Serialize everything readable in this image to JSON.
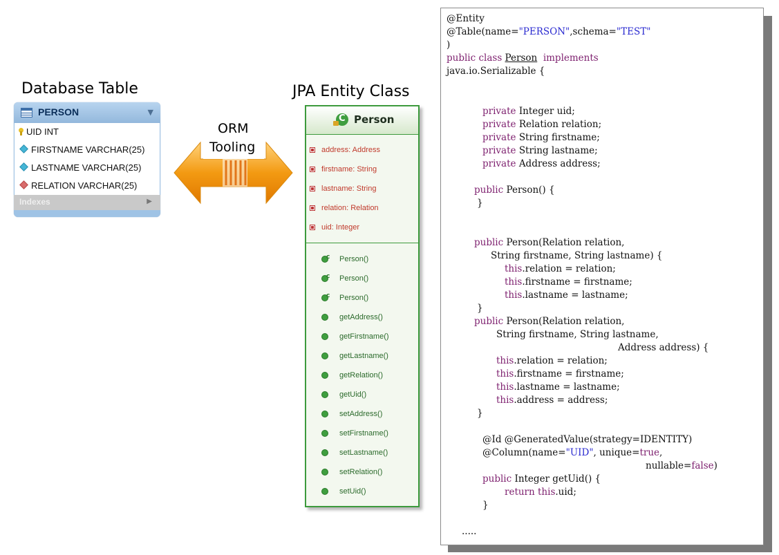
{
  "headings": {
    "db": "Database Table",
    "jpa": "JPA Entity Class",
    "orm_line1": "ORM",
    "orm_line2": "Tooling"
  },
  "db_table": {
    "name": "PERSON",
    "columns": [
      "UID INT",
      "FIRSTNAME VARCHAR(25)",
      "LASTNAME VARCHAR(25)",
      "RELATION VARCHAR(25)"
    ],
    "footer": "Indexes"
  },
  "uml": {
    "class_name": "Person",
    "attributes": [
      "address: Address",
      "firstname: String",
      "lastname: String",
      "relation: Relation",
      "uid: Integer"
    ],
    "constructors": [
      "Person()",
      "Person()",
      "Person()"
    ],
    "methods": [
      "getAddress()",
      "getFirstname()",
      "getLastname()",
      "getRelation()",
      "getUid()",
      "setAddress()",
      "setFirstname()",
      "setLastname()",
      "setRelation()",
      "setUid()"
    ]
  },
  "code": {
    "l1": "@Entity",
    "l2a": "@Table(name=",
    "l2b": "\"PERSON\"",
    "l2c": ",schema=",
    "l2d": "\"TEST\"",
    "l3": ")",
    "l4a": "public class",
    "l4b": "Person",
    "l4c": "implements",
    "l5": "java.io.Serializable {",
    "f1a": "private",
    "f1b": "Integer uid;",
    "f2a": "private",
    "f2b": "Relation relation;",
    "f3a": "private",
    "f3b": "String firstname;",
    "f4a": "private",
    "f4b": "String lastname;",
    "f5a": "private",
    "f5b": "Address address;",
    "c1a": "public",
    "c1b": "Person() {",
    "c1c": "}",
    "c2a": "public",
    "c2b": "Person(Relation relation,",
    "c2c": "String firstname, String lastname) {",
    "c2d": "this",
    "c2e": ".relation = relation;",
    "c2f": "this",
    "c2g": ".firstname = firstname;",
    "c2h": "this",
    "c2i": ".lastname = lastname;",
    "c2j": "}",
    "c3a": "public",
    "c3b": "Person(Relation relation,",
    "c3c": "String firstname, String lastname,",
    "c3d": "Address address) {",
    "c3e": "this",
    "c3f": ".relation = relation;",
    "c3g": "this",
    "c3h": ".firstname = firstname;",
    "c3i": "this",
    "c3j": ".lastname = lastname;",
    "c3k": "this",
    "c3l": ".address = address;",
    "c3m": "}",
    "a1": "@Id @GeneratedValue(strategy=IDENTITY)",
    "a2a": "@Column(name=",
    "a2b": "\"UID\"",
    "a2c": ", unique=",
    "a2d": "true",
    "a2e": ",",
    "a3a": "nullable=",
    "a3b": "false",
    "a3c": ")",
    "g1a": "public",
    "g1b": "Integer getUid() {",
    "g2a": "return this",
    "g2b": ".uid;",
    "g3": "}",
    "ellipsis": "....."
  },
  "colors": {
    "uml_border": "#3c9a3c",
    "attr_text": "#c0392b",
    "method_text": "#2b6a2b",
    "keyword": "#7d1f6e",
    "string": "#2a2ad0",
    "orm_arrow": "#f39a12"
  },
  "icons": [
    "table-icon",
    "key-icon",
    "column-diamond-icon",
    "foreign-key-diamond-icon",
    "class-icon",
    "attribute-icon",
    "constructor-icon",
    "method-icon",
    "double-arrow-icon"
  ]
}
